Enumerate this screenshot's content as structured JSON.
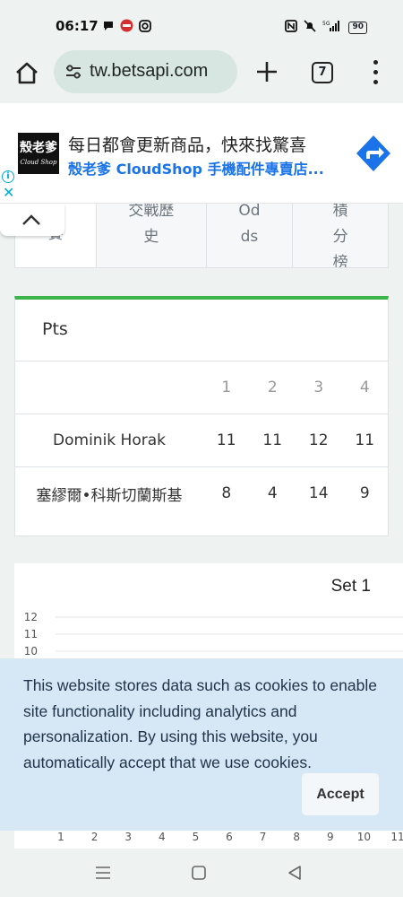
{
  "status_bar": {
    "time": "06:17",
    "battery": "90"
  },
  "browser": {
    "url": "tw.betsapi.com",
    "tab_count": "7"
  },
  "ad": {
    "logo_line1": "殼老爹",
    "logo_line2": "Cloud Shop",
    "headline": "每日都會更新商品，快來找驚喜",
    "subline": "殼老爹 CloudShop 手機配件專賣店..."
  },
  "nav_tabs": [
    {
      "label": "賽"
    },
    {
      "label": "交戰歷史"
    },
    {
      "label": "Odds"
    },
    {
      "label": "積分榜"
    }
  ],
  "pts": {
    "title": "Pts",
    "columns": [
      "1",
      "2",
      "3",
      "4"
    ],
    "rows": [
      {
        "name": "Dominik Horak",
        "scores": [
          "11",
          "11",
          "12",
          "11"
        ]
      },
      {
        "name": "塞繆爾•科斯切蘭斯基",
        "scores": [
          "8",
          "4",
          "14",
          "9"
        ]
      }
    ]
  },
  "chart_data": {
    "type": "line",
    "title": "Set 1",
    "y_ticks": [
      "12",
      "11",
      "10"
    ],
    "x_ticks": [
      "1",
      "2",
      "3",
      "4",
      "5",
      "6",
      "7",
      "8",
      "9",
      "10",
      "11"
    ]
  },
  "cookie": {
    "text": "This website stores data such as cookies to enable site functionality including analytics and personalization. By using this website, you automatically accept that we use cookies.",
    "accept_label": "Accept"
  },
  "colors": {
    "accent_green": "#3bb54a",
    "link_blue": "#1a73e8",
    "cookie_bg": "#d6e8f6"
  }
}
